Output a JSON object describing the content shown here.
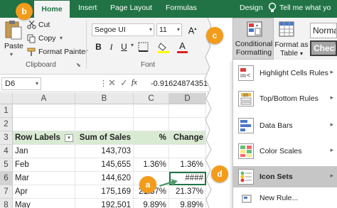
{
  "tabs": {
    "home": "Home",
    "insert": "Insert",
    "page_layout": "Page Layout",
    "formulas": "Formulas",
    "design": "Design",
    "tell_me": "Tell me what yo"
  },
  "clipboard": {
    "paste": "Paste",
    "cut": "Cut",
    "copy": "Copy",
    "format_painter": "Format Painter",
    "group": "Clipboard"
  },
  "font": {
    "family": "Segoe UI",
    "size": "11",
    "bold": "B",
    "italic": "I",
    "underline": "U",
    "font_color_letter": "A",
    "group": "Font"
  },
  "styles": {
    "conditional_formatting_line1": "Conditional",
    "conditional_formatting_line2": "Formatting",
    "format_as_table_line1": "Format as",
    "format_as_table_line2": "Table",
    "style_normal": "Norma",
    "style_check": "Check"
  },
  "formula_bar": {
    "name_box": "D6",
    "fx": "fx",
    "value": "-0.91624874351"
  },
  "columns": [
    "A",
    "B",
    "C",
    "D"
  ],
  "rows": [
    {
      "num": "1",
      "a": "",
      "b": "",
      "c": "",
      "d": ""
    },
    {
      "num": "2",
      "a": "",
      "b": "",
      "c": "",
      "d": ""
    },
    {
      "num": "3",
      "a": "Row Labels",
      "b": "Sum of Sales",
      "c": "%",
      "d": "Change"
    },
    {
      "num": "4",
      "a": "Jan",
      "b": "143,703",
      "c": "",
      "d": ""
    },
    {
      "num": "5",
      "a": "Feb",
      "b": "145,655",
      "c": "1.36%",
      "d": "1.36%"
    },
    {
      "num": "6",
      "a": "Mar",
      "b": "144,620",
      "c": "",
      "d": "####"
    },
    {
      "num": "7",
      "a": "Apr",
      "b": "175,169",
      "c": "21.37%",
      "d": "21.37%"
    },
    {
      "num": "8",
      "a": "May",
      "b": "192,501",
      "c": "9.89%",
      "d": "9.89%"
    }
  ],
  "menu": {
    "items": [
      {
        "label": "Highlight Cells Rules",
        "underline": "H"
      },
      {
        "label": "Top/Bottom Rules",
        "underline": "T"
      },
      {
        "label": "Data Bars",
        "underline": "D"
      },
      {
        "label": "Color Scales",
        "underline": "S"
      },
      {
        "label": "Icon Sets",
        "underline": "I"
      }
    ],
    "new_rule": "New Rule..."
  },
  "badges": {
    "a": "a",
    "b": "b",
    "c": "c",
    "d": "d"
  },
  "colors": {
    "excel_green": "#217346",
    "header_fill": "#d9ead3",
    "badge_orange": "#f39c1b",
    "arrow_green": "#4e9a6a"
  }
}
